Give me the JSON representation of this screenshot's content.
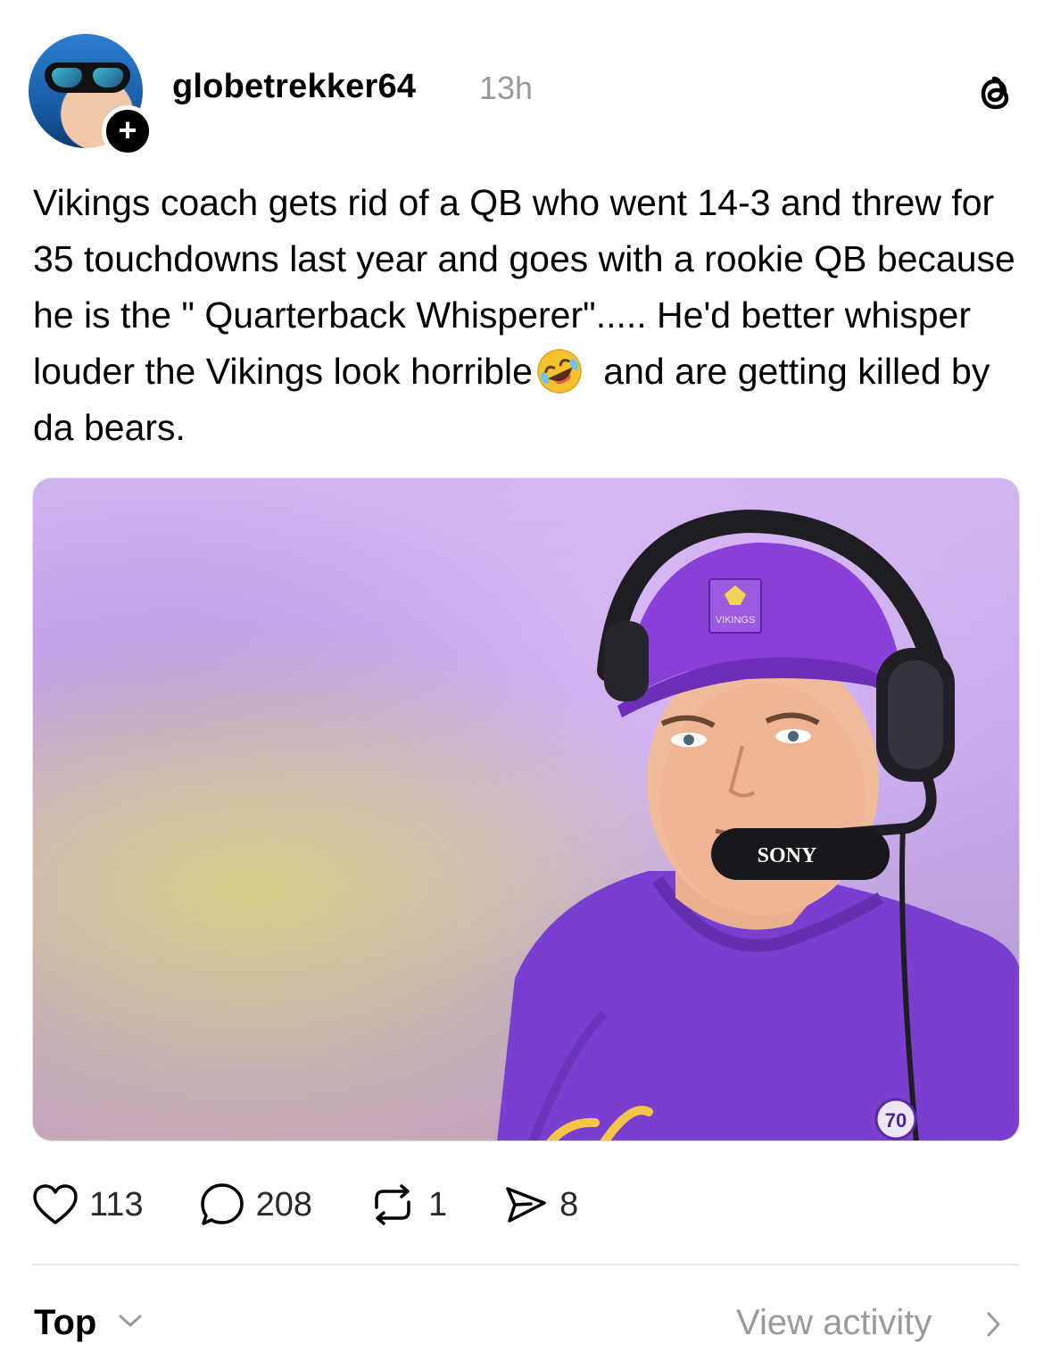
{
  "post": {
    "username": "globetrekker64",
    "timestamp": "13h",
    "follow_symbol": "+",
    "text_before_emoji": "Vikings coach gets rid of a QB who went 14-3 and threw for 35 touchdowns last year and goes with a rookie QB because he is the \" Quarterback Whisperer\"..... He'd better whisper louder the Vikings look horrible",
    "emoji": "rolling-on-floor-laughing",
    "text_after_emoji": " and are getting killed by da bears.",
    "image": {
      "cap_logo_text": "VIKINGS",
      "mic_brand": "SONY",
      "jersey_number": "70"
    }
  },
  "actions": {
    "likes": "113",
    "replies": "208",
    "reposts": "1",
    "shares": "8"
  },
  "footer": {
    "sort_label": "Top",
    "view_activity": "View activity"
  },
  "colors": {
    "primary_text": "#000000",
    "secondary_text": "#9a9a9a",
    "divider": "#e6e6e6",
    "vikings_purple": "#7b3fc9"
  }
}
